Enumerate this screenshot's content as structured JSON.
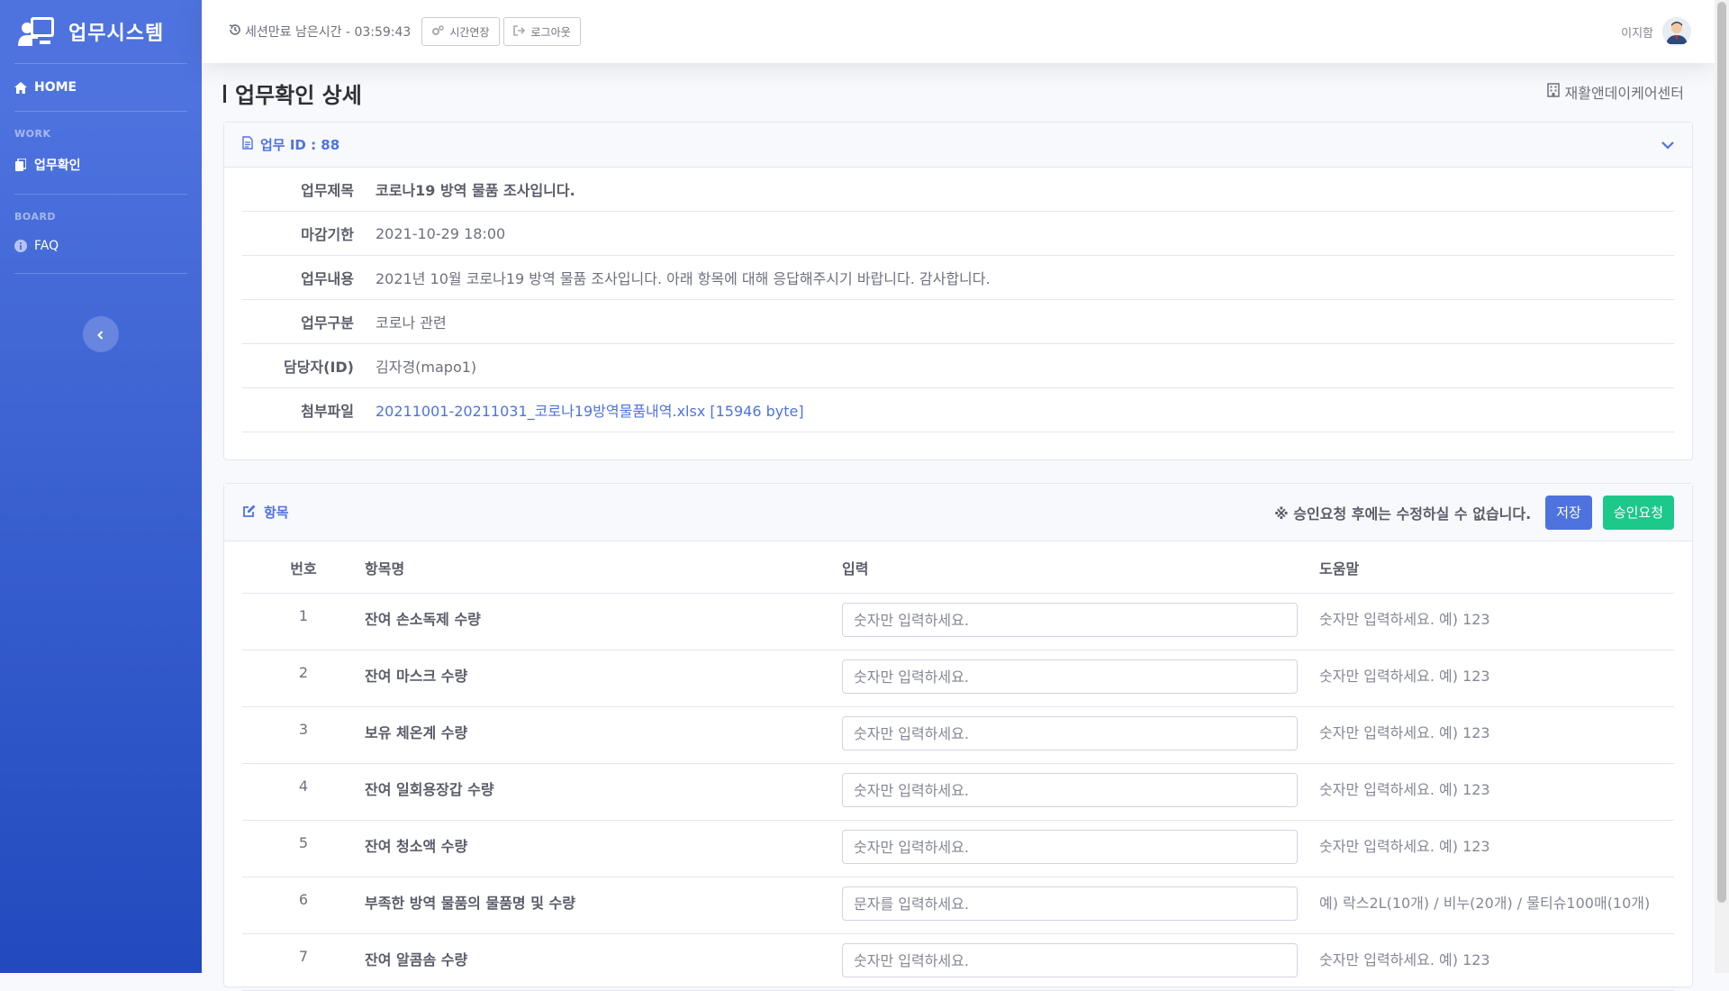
{
  "sidebar": {
    "brand": "업무시스템",
    "home": "HOME",
    "work_heading": "WORK",
    "work_item": "업무확인",
    "board_heading": "BOARD",
    "faq_item": "FAQ"
  },
  "topbar": {
    "session_text": "세션만료 남은시간 - 03:59:43",
    "extend_label": "시간연장",
    "logout_label": "로그아웃",
    "user_name": "이지함"
  },
  "page": {
    "title": "업무확인 상세",
    "center_name": "재활앤데이케어센터"
  },
  "detail": {
    "header": "업무 ID : 88",
    "rows": [
      {
        "label": "업무제목",
        "value": "코로나19 방역 물품 조사입니다."
      },
      {
        "label": "마감기한",
        "value": "2021-10-29 18:00"
      },
      {
        "label": "업무내용",
        "value": "2021년 10월 코로나19 방역 물품 조사입니다. 아래 항목에 대해 응답해주시기 바랍니다. 감사합니다."
      },
      {
        "label": "업무구분",
        "value": "코로나 관련"
      },
      {
        "label": "담당자(ID)",
        "value": "김자경(mapo1)"
      },
      {
        "label": "첨부파일",
        "value": "20211001-20211031_코로나19방역물품내역.xlsx [15946 byte]"
      }
    ]
  },
  "items": {
    "header": "항목",
    "warning": "※ 승인요청 후에는 수정하실 수 없습니다.",
    "save_label": "저장",
    "approve_label": "승인요청",
    "columns": [
      "번호",
      "항목명",
      "입력",
      "도움말"
    ],
    "rows": [
      {
        "num": "1",
        "name": "잔여 손소독제 수량",
        "placeholder": "숫자만 입력하세요.",
        "help": "숫자만 입력하세요. 예) 123"
      },
      {
        "num": "2",
        "name": "잔여 마스크 수량",
        "placeholder": "숫자만 입력하세요.",
        "help": "숫자만 입력하세요. 예) 123"
      },
      {
        "num": "3",
        "name": "보유 체온계 수량",
        "placeholder": "숫자만 입력하세요.",
        "help": "숫자만 입력하세요. 예) 123"
      },
      {
        "num": "4",
        "name": "잔여 일회용장갑 수량",
        "placeholder": "숫자만 입력하세요.",
        "help": "숫자만 입력하세요. 예) 123"
      },
      {
        "num": "5",
        "name": "잔여 청소액 수량",
        "placeholder": "숫자만 입력하세요.",
        "help": "숫자만 입력하세요. 예) 123"
      },
      {
        "num": "6",
        "name": "부족한 방역 물품의 물품명 및 수량",
        "placeholder": "문자를 입력하세요.",
        "help": "예) 락스2L(10개) / 비누(20개) / 물티슈100매(10개)"
      },
      {
        "num": "7",
        "name": "잔여 알콤솜 수량",
        "placeholder": "숫자만 입력하세요.",
        "help": "숫자만 입력하세요. 예) 123"
      }
    ]
  },
  "colors": {
    "sidebar_start": "#4e73df",
    "sidebar_end": "#224abe",
    "primary": "#4e73df",
    "success": "#1cc88a"
  }
}
